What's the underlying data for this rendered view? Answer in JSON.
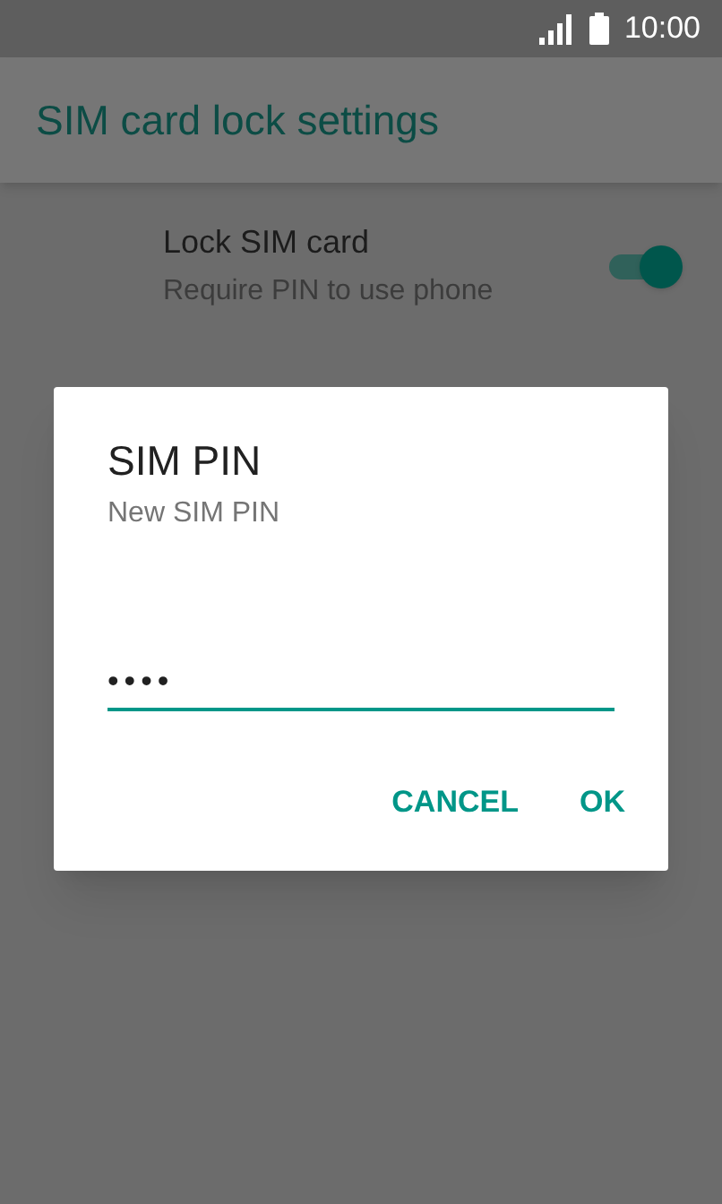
{
  "status_bar": {
    "time": "10:00"
  },
  "app_bar": {
    "title": "SIM card lock settings"
  },
  "settings": [
    {
      "title": "Lock SIM card",
      "summary": "Require PIN to use phone",
      "on": true
    }
  ],
  "dialog": {
    "title": "SIM PIN",
    "message": "New SIM PIN",
    "field": {
      "value": "••••"
    },
    "buttons": [
      "CANCEL",
      "OK"
    ]
  }
}
